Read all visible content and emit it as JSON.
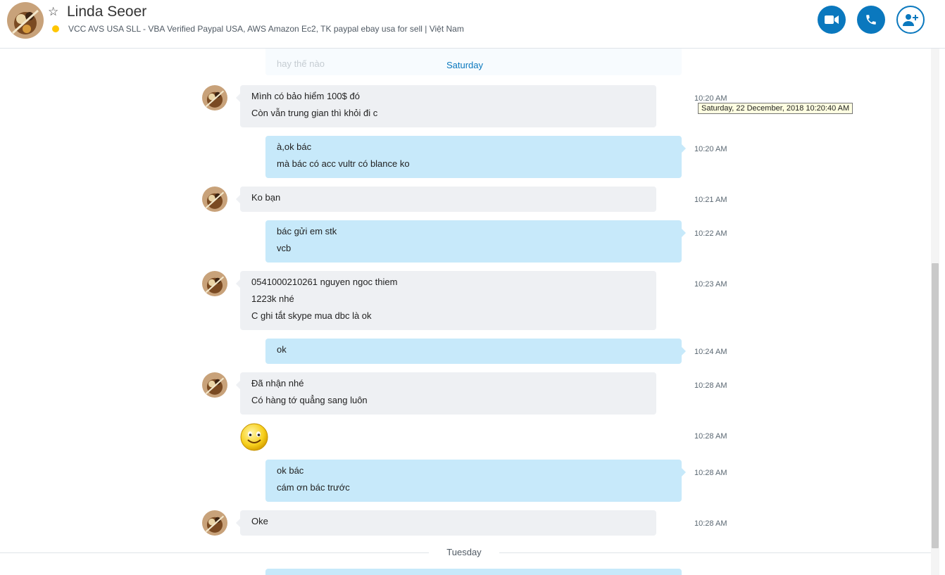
{
  "header": {
    "title": "Linda Seoer",
    "mood": "VCC AVS USA SLL - VBA Verified Paypal USA, AWS Amazon Ec2, TK paypal ebay usa for sell  |  Việt Nam",
    "buttons": [
      "video-call",
      "audio-call",
      "add-people"
    ],
    "accent_color": "#0a78be"
  },
  "conversation": {
    "ghost_text": "hay thế nào",
    "date_saturday": "Saturday",
    "date_tuesday": "Tuesday",
    "tooltip": "Saturday, 22 December, 2018 10:20:40 AM",
    "messages": [
      {
        "dir": "in",
        "lines": [
          "Mình có bảo hiểm 100$ đó",
          "Còn vẫn trung gian thì khỏi đi c"
        ],
        "time": "10:20 AM"
      },
      {
        "dir": "out",
        "lines": [
          "à,ok bác",
          "mà bác có acc vultr có blance ko"
        ],
        "time": "10:20 AM"
      },
      {
        "dir": "in",
        "lines": [
          "Ko bạn"
        ],
        "time": "10:21 AM"
      },
      {
        "dir": "out",
        "lines": [
          "bác gửi em stk",
          "vcb"
        ],
        "time": "10:22 AM"
      },
      {
        "dir": "in",
        "lines": [
          "0541000210261 nguyen ngoc thiem",
          "1223k nhé",
          "C ghi tắt skype mua dbc là ok"
        ],
        "time": "10:23 AM"
      },
      {
        "dir": "out",
        "lines": [
          "ok"
        ],
        "time": "10:24 AM"
      },
      {
        "dir": "in",
        "lines": [
          "Đã nhận nhé",
          "Có hàng tớ quẳng sang luôn"
        ],
        "time": "10:28 AM"
      },
      {
        "dir": "in-emoji",
        "lines": [],
        "time": "10:28 AM"
      },
      {
        "dir": "out",
        "lines": [
          "ok bác",
          "cám ơn bác trước"
        ],
        "time": "10:28 AM"
      },
      {
        "dir": "in",
        "lines": [
          "Oke"
        ],
        "time": "10:28 AM"
      }
    ]
  }
}
